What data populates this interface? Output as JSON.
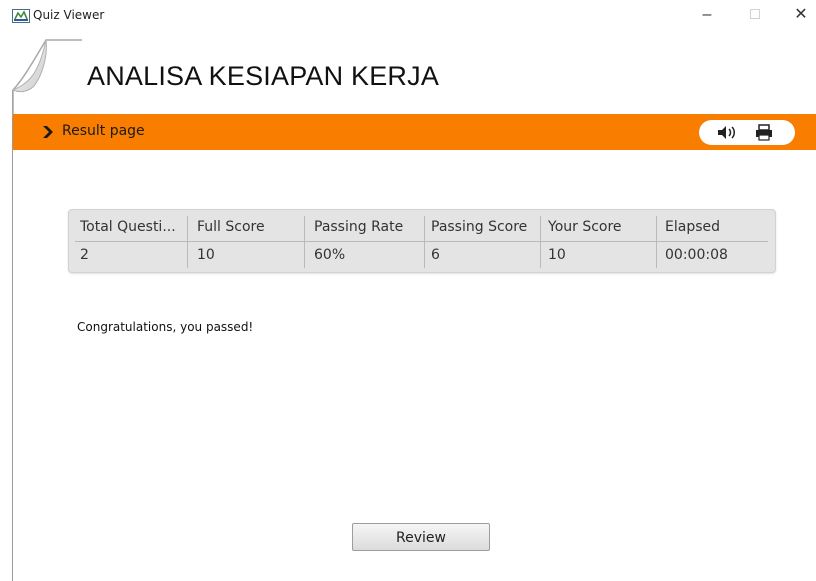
{
  "window": {
    "title": "Quiz Viewer",
    "icons": {
      "app": "quiz-viewer-app-icon",
      "minimize": "minimize-icon",
      "maximize": "maximize-icon",
      "close": "close-icon"
    },
    "controls": {
      "minimize": "–",
      "maximize": "□",
      "close": "✕"
    }
  },
  "header": {
    "title": "ANALISA KESIAPAN KERJA"
  },
  "toolbar": {
    "section_label": "Result page",
    "accent_color": "#f97e00",
    "icons": {
      "section": "arrow-right-icon",
      "audio": "speaker-icon",
      "print": "printer-icon"
    }
  },
  "results": {
    "columns": [
      "Total Questi...",
      "Full Score",
      "Passing Rate",
      "Passing Score",
      "Your Score",
      "Elapsed"
    ],
    "values": [
      "2",
      "10",
      "60%",
      "6",
      "10",
      "00:00:08"
    ]
  },
  "message": "Congratulations, you passed!",
  "review_button": "Review"
}
